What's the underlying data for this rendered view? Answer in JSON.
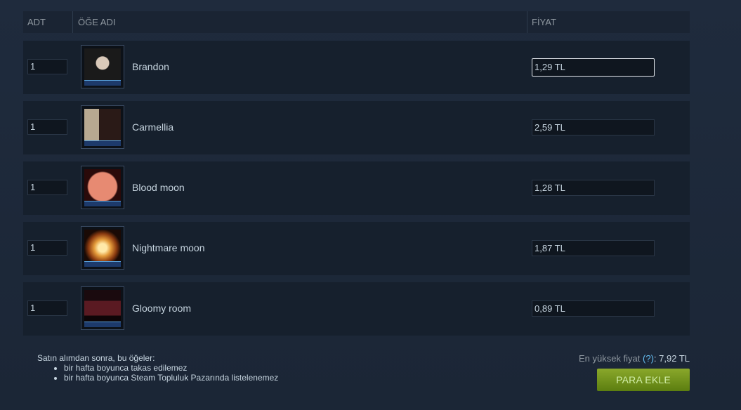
{
  "table": {
    "headers": {
      "qty": "ADT",
      "item": "ÖĞE ADI",
      "price": "FİYAT"
    },
    "rows": [
      {
        "qty": "1",
        "name": "Brandon",
        "price": "1,29 TL",
        "focused": true
      },
      {
        "qty": "1",
        "name": "Carmellia",
        "price": "2,59 TL",
        "focused": false
      },
      {
        "qty": "1",
        "name": "Blood moon",
        "price": "1,28 TL",
        "focused": false
      },
      {
        "qty": "1",
        "name": "Nightmare moon",
        "price": "1,87 TL",
        "focused": false
      },
      {
        "qty": "1",
        "name": "Gloomy room",
        "price": "0,89 TL",
        "focused": false
      }
    ]
  },
  "notes": {
    "intro": "Satın alımdan sonra, bu öğeler:",
    "items": [
      "bir hafta boyunca takas edilemez",
      "bir hafta boyunca Steam Topluluk Pazarında listelenemez"
    ]
  },
  "summary": {
    "max_label": "En yüksek fiyat",
    "help": "(?)",
    "max_value": ": 7,92 TL"
  },
  "action": {
    "add_funds": "PARA EKLE"
  },
  "colors": {
    "accent_link": "#66c0f4",
    "button_green": "#6c8f1a"
  }
}
